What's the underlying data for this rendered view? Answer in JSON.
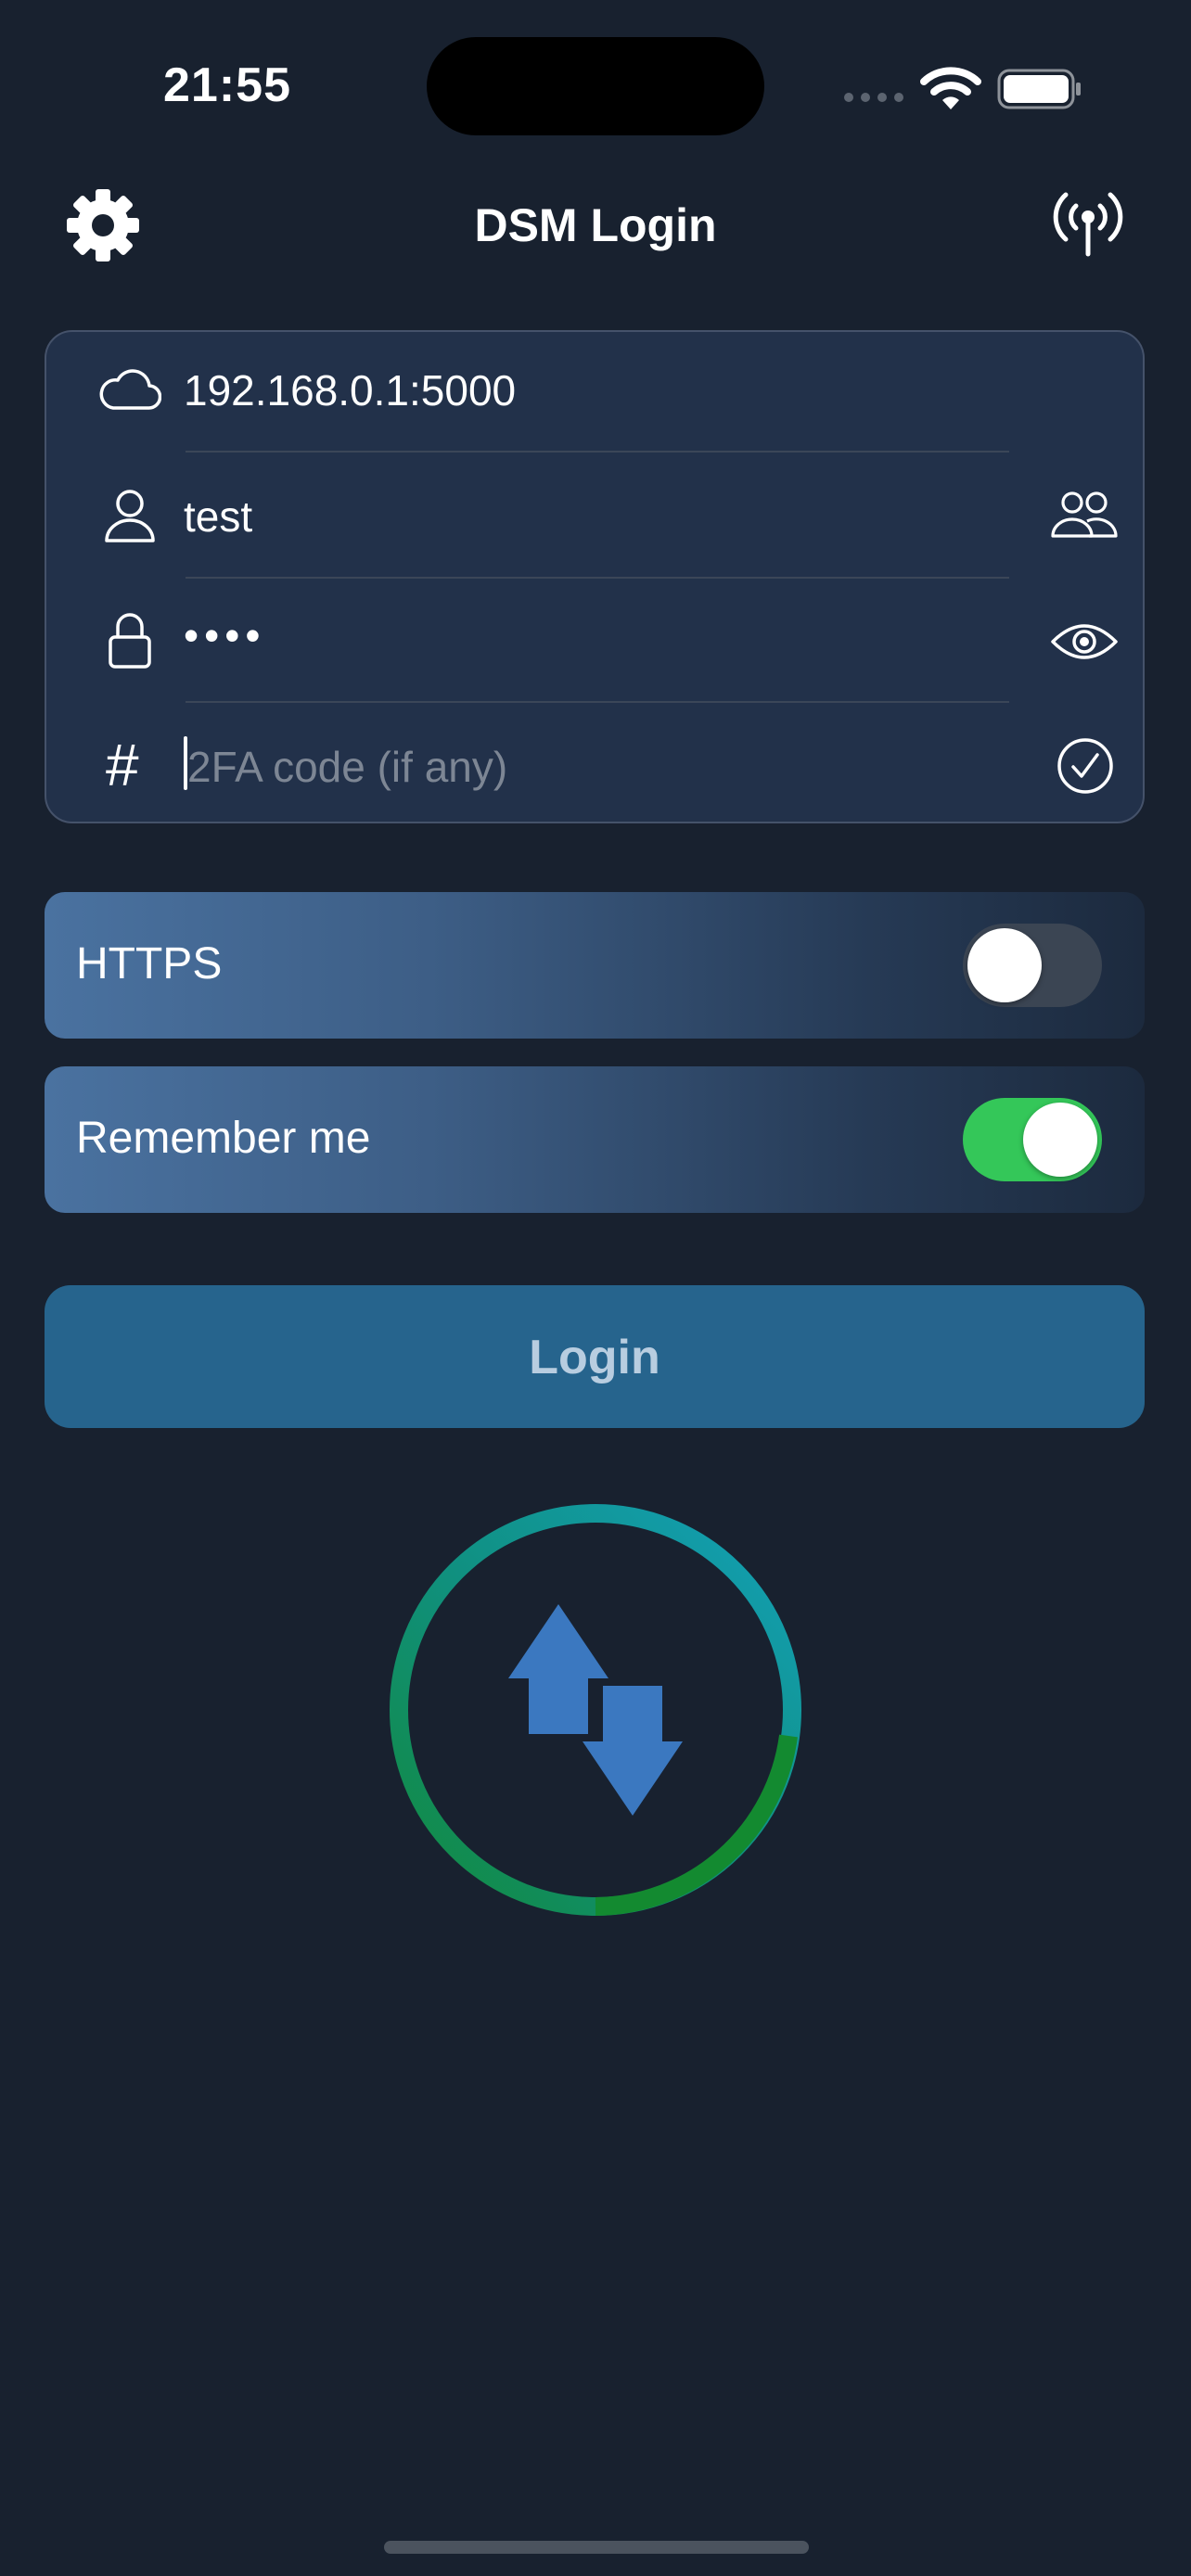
{
  "status_bar": {
    "time": "21:55"
  },
  "header": {
    "title": "DSM Login",
    "left_icon": "gear-icon",
    "right_icon": "antenna-icon"
  },
  "form": {
    "server": {
      "value": "192.168.0.1:5000",
      "icon": "cloud-icon"
    },
    "username": {
      "value": "test",
      "icon": "person-icon",
      "action_icon": "people-icon"
    },
    "password": {
      "value": "••••",
      "icon": "lock-icon",
      "action_icon": "eye-icon"
    },
    "otp": {
      "value": "",
      "placeholder": "2FA code (if any)",
      "icon": "hash-icon",
      "action_icon": "checkmark-circle-icon"
    }
  },
  "options": {
    "https": {
      "label": "HTTPS",
      "enabled": false
    },
    "remember": {
      "label": "Remember me",
      "enabled": true
    }
  },
  "login_button": {
    "label": "Login"
  },
  "colors": {
    "background": "#18212f",
    "card": "#22314a",
    "button": "#26648d",
    "toggle_on": "#34c759",
    "logo_arrows": "#3b78c0"
  }
}
